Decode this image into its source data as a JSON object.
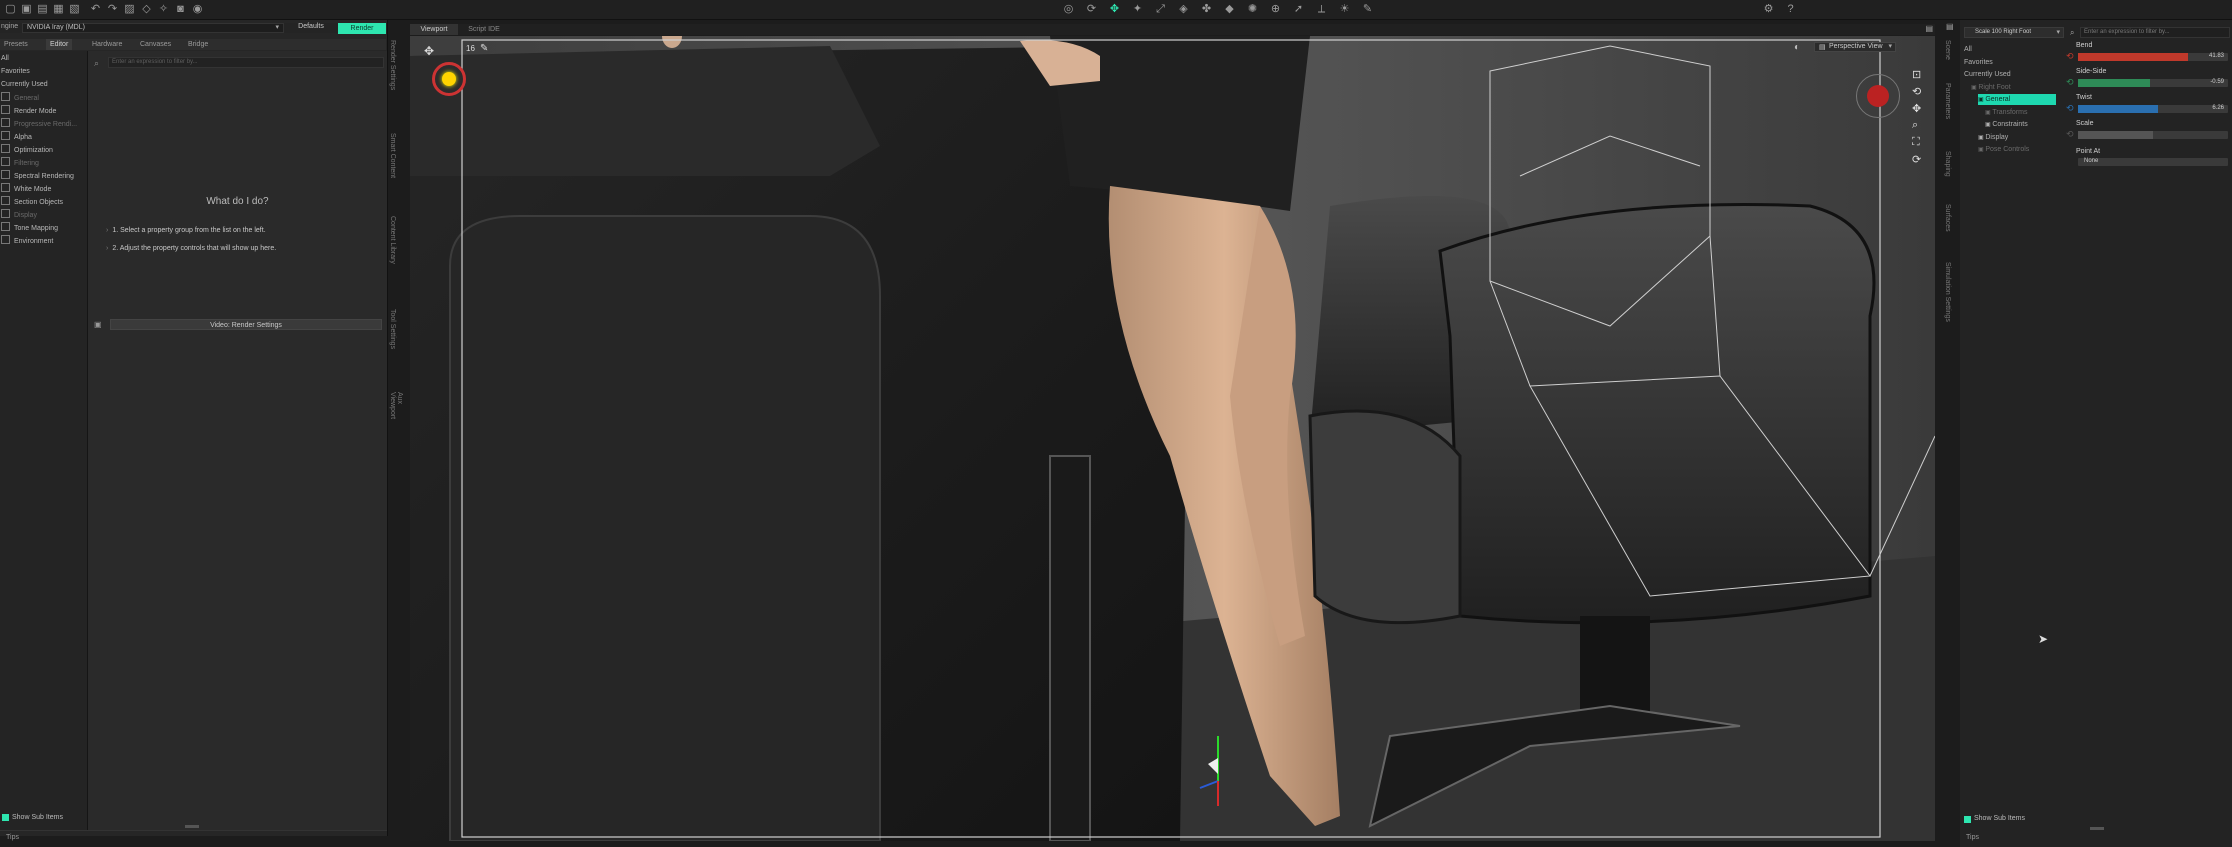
{
  "toolbar": {
    "left_icons": [
      "new-file-icon",
      "open-file-icon",
      "open-recent-icon",
      "save-icon",
      "save-as-icon",
      "undo-icon",
      "redo-icon",
      "scene-icon",
      "node-selection-icon",
      "joint-editor-icon",
      "camera-icon",
      "render-icon"
    ],
    "center_icons": [
      "orbit-icon",
      "rotate-icon",
      "translate-icon",
      "universal-icon",
      "scale-icon",
      "geometry-editor-icon",
      "figure-tool-icon",
      "surface-selection-icon",
      "node-weight-icon",
      "region-nav-icon",
      "pointer-icon",
      "align-icon",
      "spotlight-icon",
      "pen-icon"
    ],
    "right_icons": [
      "settings-icon",
      "help-icon"
    ]
  },
  "left": {
    "engine_label": "ngine",
    "engine_value": "NVIDIA Iray (MDL)",
    "defaults_btn": "Defaults",
    "render_btn": "Render",
    "tabs": [
      "Presets",
      "Editor",
      "Hardware",
      "Canvases",
      "Bridge"
    ],
    "filter_placeholder": "Enter an expression to filter by...",
    "groups": [
      {
        "label": "All",
        "dim": false,
        "box": false
      },
      {
        "label": "Favorites",
        "dim": false,
        "box": false
      },
      {
        "label": "Currently Used",
        "dim": false,
        "box": false
      },
      {
        "label": "General",
        "dim": true,
        "box": true
      },
      {
        "label": "Render Mode",
        "dim": false,
        "box": true
      },
      {
        "label": "Progressive Rendi...",
        "dim": true,
        "box": true
      },
      {
        "label": "Alpha",
        "dim": false,
        "box": true
      },
      {
        "label": "Optimization",
        "dim": false,
        "box": true
      },
      {
        "label": "Filtering",
        "dim": true,
        "box": true
      },
      {
        "label": "Spectral Rendering",
        "dim": false,
        "box": true
      },
      {
        "label": "White Mode",
        "dim": false,
        "box": true
      },
      {
        "label": "Section Objects",
        "dim": false,
        "box": true
      },
      {
        "label": "Display",
        "dim": true,
        "box": true
      },
      {
        "label": "Tone Mapping",
        "dim": false,
        "box": true
      },
      {
        "label": "Environment",
        "dim": false,
        "box": true
      }
    ],
    "help_title": "What do I do?",
    "help_step1": "1. Select a property group from the list on the left.",
    "help_step2": "2. Adjust the property controls that will show up here.",
    "video_btn": "Video: Render Settings",
    "show_sub_items": "Show Sub Items",
    "tips": "Tips"
  },
  "side_tabs_left": [
    "Render Settings",
    "Smart Content",
    "Content Library",
    "Tool Settings",
    "Aux Viewport"
  ],
  "viewport": {
    "tabs": [
      "Viewport",
      "Script IDE"
    ],
    "view_label": "Perspective View",
    "fps_label": "16"
  },
  "right": {
    "node_label": "Scale 100 Right Foot",
    "filter_placeholder": "Enter an expression to filter by...",
    "tree": [
      {
        "label": "All",
        "indent": 0,
        "state": "normal"
      },
      {
        "label": "Favorites",
        "indent": 0,
        "state": "normal"
      },
      {
        "label": "Currently Used",
        "indent": 0,
        "state": "normal"
      },
      {
        "label": "Right Foot",
        "indent": 1,
        "state": "dim"
      },
      {
        "label": "General",
        "indent": 2,
        "state": "selected"
      },
      {
        "label": "Transforms",
        "indent": 3,
        "state": "dim"
      },
      {
        "label": "Constraints",
        "indent": 3,
        "state": "normal"
      },
      {
        "label": "Display",
        "indent": 2,
        "state": "normal"
      },
      {
        "label": "Pose Controls",
        "indent": 2,
        "state": "dim"
      }
    ],
    "sliders": [
      {
        "label": "Bend",
        "value": "41.83",
        "color": "#c0392b",
        "fill": 0.73
      },
      {
        "label": "Side-Side",
        "value": "-0.59",
        "color": "#2e8b57",
        "fill": 0.48
      },
      {
        "label": "Twist",
        "value": "6.26",
        "color": "#2a6fb0",
        "fill": 0.53
      },
      {
        "label": "Scale",
        "value": "",
        "color": "#555555",
        "fill": 0.5
      }
    ],
    "point_at_label": "Point At",
    "point_at_value": "None",
    "show_sub_items": "Show Sub Items",
    "tips": "Tips"
  },
  "side_tabs_right": [
    "Scene",
    "Parameters",
    "Shaping",
    "Surfaces",
    "Simulation Settings"
  ],
  "colors": {
    "accent": "#2ee6b0",
    "selected": "#1ed8b0"
  }
}
